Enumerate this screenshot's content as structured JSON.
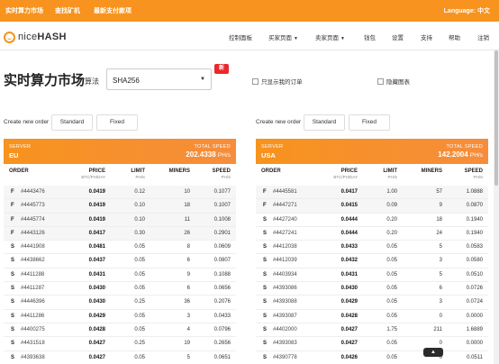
{
  "topbar": {
    "links": [
      "实时算力市场",
      "查找矿机",
      "最新支付款项"
    ],
    "language": "Language: 中文",
    "bg_color": "#f7931e"
  },
  "nav": {
    "logo_light": "nice",
    "logo_bold": "HASH",
    "items": [
      {
        "label": "控制面板",
        "dropdown": false
      },
      {
        "label": "买家页面",
        "dropdown": true
      },
      {
        "label": "卖家页面",
        "dropdown": true
      },
      {
        "label": "钱包",
        "dropdown": false
      },
      {
        "label": "设置",
        "dropdown": false
      },
      {
        "label": "支持",
        "dropdown": false
      },
      {
        "label": "帮助",
        "dropdown": false
      },
      {
        "label": "注销",
        "dropdown": false
      }
    ]
  },
  "page": {
    "title": "实时算力市场",
    "algo_label": "算法",
    "algo_value": "SHA256",
    "new_badge": "新",
    "show_my_orders": "只显示我的订单",
    "hide_charts": "隐藏图表"
  },
  "left": {
    "create_label": "Create new order",
    "btn_standard": "Standard",
    "btn_fixed": "Fixed",
    "server_label": "SERVER",
    "server": "EU",
    "speed_label": "TOTAL SPEED",
    "speed_value": "202.4338",
    "speed_unit": "PH/s",
    "rows": [
      {
        "type": "F",
        "id": "#4443476",
        "price": "0.0419",
        "limit": "0.12",
        "miners": "10",
        "speed": "0.1077"
      },
      {
        "type": "F",
        "id": "#4445773",
        "price": "0.0419",
        "limit": "0.10",
        "miners": "18",
        "speed": "0.1007"
      },
      {
        "type": "F",
        "id": "#4445774",
        "price": "0.0419",
        "limit": "0.10",
        "miners": "11",
        "speed": "0.1008"
      },
      {
        "type": "F",
        "id": "#4443126",
        "price": "0.0417",
        "limit": "0.30",
        "miners": "26",
        "speed": "0.2901"
      },
      {
        "type": "S",
        "id": "#4441908",
        "price": "0.0481",
        "limit": "0.05",
        "miners": "8",
        "speed": "0.0609"
      },
      {
        "type": "S",
        "id": "#4438662",
        "price": "0.0437",
        "limit": "0.05",
        "miners": "6",
        "speed": "0.0807"
      },
      {
        "type": "S",
        "id": "#4411288",
        "price": "0.0431",
        "limit": "0.05",
        "miners": "9",
        "speed": "0.1088"
      },
      {
        "type": "S",
        "id": "#4411287",
        "price": "0.0430",
        "limit": "0.05",
        "miners": "6",
        "speed": "0.0656"
      },
      {
        "type": "S",
        "id": "#4446396",
        "price": "0.0430",
        "limit": "0.25",
        "miners": "36",
        "speed": "0.2076"
      },
      {
        "type": "S",
        "id": "#4411286",
        "price": "0.0429",
        "limit": "0.05",
        "miners": "3",
        "speed": "0.0433"
      },
      {
        "type": "S",
        "id": "#4400275",
        "price": "0.0428",
        "limit": "0.05",
        "miners": "4",
        "speed": "0.0796"
      },
      {
        "type": "S",
        "id": "#4431518",
        "price": "0.0427",
        "limit": "0.25",
        "miners": "19",
        "speed": "0.2656"
      },
      {
        "type": "S",
        "id": "#4393638",
        "price": "0.0427",
        "limit": "0.05",
        "miners": "5",
        "speed": "0.0651"
      }
    ]
  },
  "right": {
    "create_label": "Create new order",
    "btn_standard": "Standard",
    "btn_fixed": "Fixed",
    "server_label": "SERVER",
    "server": "USA",
    "speed_label": "TOTAL SPEED",
    "speed_value": "142.2004",
    "speed_unit": "PH/s",
    "rows": [
      {
        "type": "F",
        "id": "#4445581",
        "price": "0.0417",
        "limit": "1.00",
        "miners": "57",
        "speed": "1.0888"
      },
      {
        "type": "F",
        "id": "#4447271",
        "price": "0.0415",
        "limit": "0.09",
        "miners": "9",
        "speed": "0.0870"
      },
      {
        "type": "S",
        "id": "#4427240",
        "price": "0.0444",
        "limit": "0.20",
        "miners": "18",
        "speed": "0.1940"
      },
      {
        "type": "S",
        "id": "#4427241",
        "price": "0.0444",
        "limit": "0.20",
        "miners": "24",
        "speed": "0.1940"
      },
      {
        "type": "S",
        "id": "#4412038",
        "price": "0.0433",
        "limit": "0.05",
        "miners": "5",
        "speed": "0.0583"
      },
      {
        "type": "S",
        "id": "#4412039",
        "price": "0.0432",
        "limit": "0.05",
        "miners": "3",
        "speed": "0.0580"
      },
      {
        "type": "S",
        "id": "#4403934",
        "price": "0.0431",
        "limit": "0.05",
        "miners": "5",
        "speed": "0.0510"
      },
      {
        "type": "S",
        "id": "#4393086",
        "price": "0.0430",
        "limit": "0.05",
        "miners": "6",
        "speed": "0.0726"
      },
      {
        "type": "S",
        "id": "#4393088",
        "price": "0.0429",
        "limit": "0.05",
        "miners": "3",
        "speed": "0.0724"
      },
      {
        "type": "S",
        "id": "#4393087",
        "price": "0.0428",
        "limit": "0.05",
        "miners": "0",
        "speed": "0.0000"
      },
      {
        "type": "S",
        "id": "#4402000",
        "price": "0.0427",
        "limit": "1.75",
        "miners": "211",
        "speed": "1.6889"
      },
      {
        "type": "S",
        "id": "#4393083",
        "price": "0.0427",
        "limit": "0.05",
        "miners": "0",
        "speed": "0.0000"
      },
      {
        "type": "S",
        "id": "#4390778",
        "price": "0.0426",
        "limit": "0.05",
        "miners": "0",
        "speed": "0.0511"
      }
    ]
  },
  "columns": {
    "order": "ORDER",
    "price": "PRICE",
    "price_sub": "BTC/PH/DAY",
    "limit": "LIMIT",
    "limit_sub": "PH/S",
    "miners": "MINERS",
    "speed": "SPEED",
    "speed_sub": "PH/S"
  },
  "back_to_top": "▲"
}
